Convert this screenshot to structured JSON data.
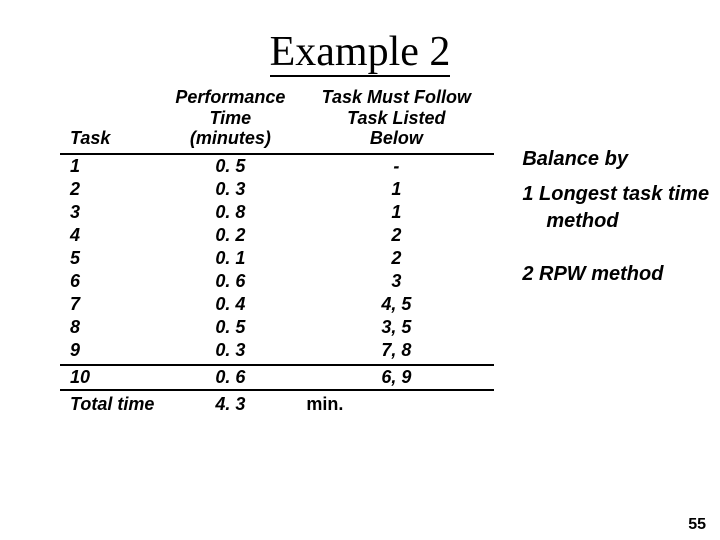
{
  "title": "Example 2",
  "headers": {
    "task": "Task",
    "time": "Performance Time (minutes)",
    "follow": "Task Must Follow Task Listed Below"
  },
  "rows": [
    {
      "task": "1",
      "time": "0. 5",
      "follow": "-"
    },
    {
      "task": "2",
      "time": "0. 3",
      "follow": "1"
    },
    {
      "task": "3",
      "time": "0. 8",
      "follow": "1"
    },
    {
      "task": "4",
      "time": "0. 2",
      "follow": "2"
    },
    {
      "task": "5",
      "time": "0. 1",
      "follow": "2"
    },
    {
      "task": "6",
      "time": "0. 6",
      "follow": "3"
    },
    {
      "task": "7",
      "time": "0. 4",
      "follow": "4, 5"
    },
    {
      "task": "8",
      "time": "0. 5",
      "follow": "3, 5"
    },
    {
      "task": "9",
      "time": "0. 3",
      "follow": "7, 8"
    },
    {
      "task": "10",
      "time": "0. 6",
      "follow": "6, 9"
    }
  ],
  "total": {
    "label": "Total time",
    "value": "4. 3",
    "unit": "min."
  },
  "side": {
    "balance": "Balance by",
    "method1_a": "1 Longest task time",
    "method1_b": "method",
    "method2": "2 RPW method"
  },
  "page_number": "55"
}
